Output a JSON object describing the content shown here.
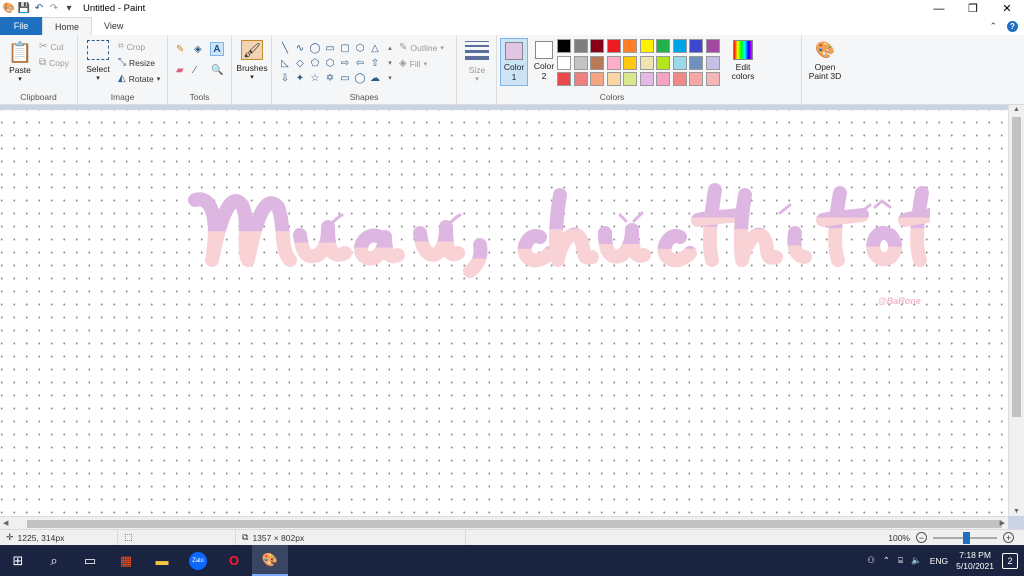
{
  "window": {
    "title": "Untitled - Paint"
  },
  "tabs": [
    {
      "label": "File"
    },
    {
      "label": "Home"
    },
    {
      "label": "View"
    }
  ],
  "ribbon": {
    "clipboard": {
      "label": "Clipboard",
      "paste": "Paste",
      "cut": "Cut",
      "copy": "Copy"
    },
    "image": {
      "label": "Image",
      "select": "Select",
      "crop": "Crop",
      "resize": "Resize",
      "rotate": "Rotate"
    },
    "tools": {
      "label": "Tools"
    },
    "brushes": {
      "label": "Brushes"
    },
    "shapes": {
      "label": "Shapes",
      "outline": "Outline",
      "fill": "Fill"
    },
    "size": {
      "label": "Size"
    },
    "colors": {
      "label": "Colors",
      "color1_label": "Color",
      "color1_num": "1",
      "color2_label": "Color",
      "color2_num": "2",
      "color1_value": "#e2c5e6",
      "color2_value": "#ffffff",
      "edit_colors": "Edit colors",
      "paint3d": "Open Paint 3D",
      "palette": [
        "#000000",
        "#7f7f7f",
        "#880015",
        "#ed1c24",
        "#ff7f27",
        "#fff200",
        "#22b14c",
        "#00a2e8",
        "#3f48cc",
        "#a349a4",
        "#ffffff",
        "#c3c3c3",
        "#b97a57",
        "#ffaec9",
        "#ffc90e",
        "#efe4b0",
        "#b5e61d",
        "#99d9ea",
        "#7092be",
        "#c8bfe7",
        "#e84a4a",
        "#f08080",
        "#f4a582",
        "#fcd5a5",
        "#d9e88a",
        "#e6b8e6",
        "#f4a3c4",
        "#f08a8a",
        "#f7a6a6",
        "#f5b8b8"
      ]
    }
  },
  "canvas": {
    "watermark": "@BaRone"
  },
  "status": {
    "cursor": "1225, 314px",
    "canvas_size": "1357 × 802px",
    "zoom": "100%"
  },
  "taskbar": {
    "lang": "ENG",
    "time": "7:18 PM",
    "date": "5/10/2021",
    "notifications": "2"
  }
}
